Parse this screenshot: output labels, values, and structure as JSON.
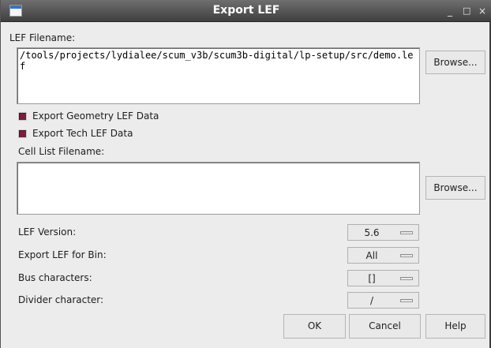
{
  "window": {
    "title": "Export LEF",
    "controls": {
      "minimize": "_",
      "maximize": "□",
      "close": "×"
    }
  },
  "lef_filename": {
    "label": "LEF Filename:",
    "value": "/tools/projects/lydialee/scum_v3b/scum3b-digital/lp-setup/src/demo.lef",
    "browse_label": "Browse..."
  },
  "options": {
    "export_geometry": {
      "label": "Export Geometry LEF Data",
      "checked": true
    },
    "export_tech": {
      "label": "Export Tech LEF Data",
      "checked": true
    }
  },
  "cell_list": {
    "label": "Cell List Filename:",
    "value": "",
    "browse_label": "Browse..."
  },
  "settings": {
    "lef_version": {
      "label": "LEF Version:",
      "value": "5.6"
    },
    "export_for_bin": {
      "label": "Export LEF for Bin:",
      "value": "All"
    },
    "bus_characters": {
      "label": "Bus characters:",
      "value": "[]"
    },
    "divider_character": {
      "label": "Divider character:",
      "value": "/"
    }
  },
  "footer": {
    "ok_label": "OK",
    "cancel_label": "Cancel",
    "help_label": "Help"
  },
  "colors": {
    "titlebar": "#4f4f4f",
    "checkbox": "#7c1c3f",
    "background": "#ececec"
  }
}
